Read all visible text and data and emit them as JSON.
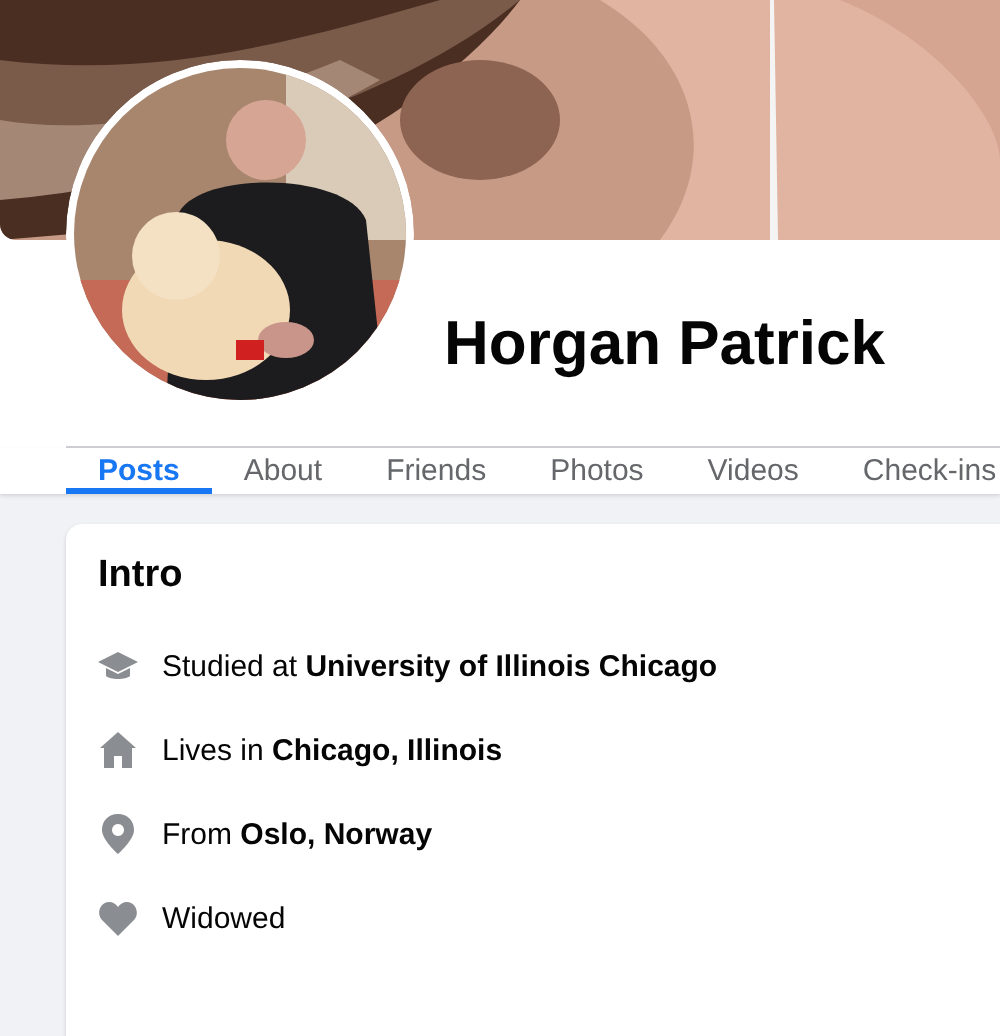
{
  "profile": {
    "name": "Horgan Patrick"
  },
  "tabs": [
    {
      "label": "Posts",
      "selected": true
    },
    {
      "label": "About",
      "selected": false
    },
    {
      "label": "Friends",
      "selected": false
    },
    {
      "label": "Photos",
      "selected": false
    },
    {
      "label": "Videos",
      "selected": false
    },
    {
      "label": "Check-ins",
      "selected": false
    }
  ],
  "intro": {
    "title": "Intro",
    "items": [
      {
        "kind": "education",
        "text": "Studied at **University of Illinois Chicago**"
      },
      {
        "kind": "home",
        "text": "Lives in **Chicago, Illinois**"
      },
      {
        "kind": "origin",
        "text": "From **Oslo, Norway**"
      },
      {
        "kind": "relationship",
        "text": "Widowed"
      }
    ]
  }
}
